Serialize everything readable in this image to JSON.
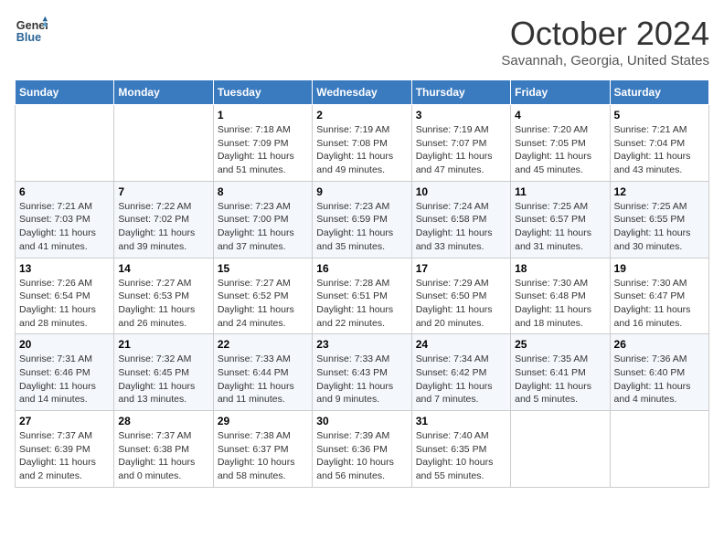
{
  "logo": {
    "line1": "General",
    "line2": "Blue"
  },
  "title": "October 2024",
  "subtitle": "Savannah, Georgia, United States",
  "days_of_week": [
    "Sunday",
    "Monday",
    "Tuesday",
    "Wednesday",
    "Thursday",
    "Friday",
    "Saturday"
  ],
  "weeks": [
    [
      {
        "day": "",
        "info": ""
      },
      {
        "day": "",
        "info": ""
      },
      {
        "day": "1",
        "info": "Sunrise: 7:18 AM\nSunset: 7:09 PM\nDaylight: 11 hours and 51 minutes."
      },
      {
        "day": "2",
        "info": "Sunrise: 7:19 AM\nSunset: 7:08 PM\nDaylight: 11 hours and 49 minutes."
      },
      {
        "day": "3",
        "info": "Sunrise: 7:19 AM\nSunset: 7:07 PM\nDaylight: 11 hours and 47 minutes."
      },
      {
        "day": "4",
        "info": "Sunrise: 7:20 AM\nSunset: 7:05 PM\nDaylight: 11 hours and 45 minutes."
      },
      {
        "day": "5",
        "info": "Sunrise: 7:21 AM\nSunset: 7:04 PM\nDaylight: 11 hours and 43 minutes."
      }
    ],
    [
      {
        "day": "6",
        "info": "Sunrise: 7:21 AM\nSunset: 7:03 PM\nDaylight: 11 hours and 41 minutes."
      },
      {
        "day": "7",
        "info": "Sunrise: 7:22 AM\nSunset: 7:02 PM\nDaylight: 11 hours and 39 minutes."
      },
      {
        "day": "8",
        "info": "Sunrise: 7:23 AM\nSunset: 7:00 PM\nDaylight: 11 hours and 37 minutes."
      },
      {
        "day": "9",
        "info": "Sunrise: 7:23 AM\nSunset: 6:59 PM\nDaylight: 11 hours and 35 minutes."
      },
      {
        "day": "10",
        "info": "Sunrise: 7:24 AM\nSunset: 6:58 PM\nDaylight: 11 hours and 33 minutes."
      },
      {
        "day": "11",
        "info": "Sunrise: 7:25 AM\nSunset: 6:57 PM\nDaylight: 11 hours and 31 minutes."
      },
      {
        "day": "12",
        "info": "Sunrise: 7:25 AM\nSunset: 6:55 PM\nDaylight: 11 hours and 30 minutes."
      }
    ],
    [
      {
        "day": "13",
        "info": "Sunrise: 7:26 AM\nSunset: 6:54 PM\nDaylight: 11 hours and 28 minutes."
      },
      {
        "day": "14",
        "info": "Sunrise: 7:27 AM\nSunset: 6:53 PM\nDaylight: 11 hours and 26 minutes."
      },
      {
        "day": "15",
        "info": "Sunrise: 7:27 AM\nSunset: 6:52 PM\nDaylight: 11 hours and 24 minutes."
      },
      {
        "day": "16",
        "info": "Sunrise: 7:28 AM\nSunset: 6:51 PM\nDaylight: 11 hours and 22 minutes."
      },
      {
        "day": "17",
        "info": "Sunrise: 7:29 AM\nSunset: 6:50 PM\nDaylight: 11 hours and 20 minutes."
      },
      {
        "day": "18",
        "info": "Sunrise: 7:30 AM\nSunset: 6:48 PM\nDaylight: 11 hours and 18 minutes."
      },
      {
        "day": "19",
        "info": "Sunrise: 7:30 AM\nSunset: 6:47 PM\nDaylight: 11 hours and 16 minutes."
      }
    ],
    [
      {
        "day": "20",
        "info": "Sunrise: 7:31 AM\nSunset: 6:46 PM\nDaylight: 11 hours and 14 minutes."
      },
      {
        "day": "21",
        "info": "Sunrise: 7:32 AM\nSunset: 6:45 PM\nDaylight: 11 hours and 13 minutes."
      },
      {
        "day": "22",
        "info": "Sunrise: 7:33 AM\nSunset: 6:44 PM\nDaylight: 11 hours and 11 minutes."
      },
      {
        "day": "23",
        "info": "Sunrise: 7:33 AM\nSunset: 6:43 PM\nDaylight: 11 hours and 9 minutes."
      },
      {
        "day": "24",
        "info": "Sunrise: 7:34 AM\nSunset: 6:42 PM\nDaylight: 11 hours and 7 minutes."
      },
      {
        "day": "25",
        "info": "Sunrise: 7:35 AM\nSunset: 6:41 PM\nDaylight: 11 hours and 5 minutes."
      },
      {
        "day": "26",
        "info": "Sunrise: 7:36 AM\nSunset: 6:40 PM\nDaylight: 11 hours and 4 minutes."
      }
    ],
    [
      {
        "day": "27",
        "info": "Sunrise: 7:37 AM\nSunset: 6:39 PM\nDaylight: 11 hours and 2 minutes."
      },
      {
        "day": "28",
        "info": "Sunrise: 7:37 AM\nSunset: 6:38 PM\nDaylight: 11 hours and 0 minutes."
      },
      {
        "day": "29",
        "info": "Sunrise: 7:38 AM\nSunset: 6:37 PM\nDaylight: 10 hours and 58 minutes."
      },
      {
        "day": "30",
        "info": "Sunrise: 7:39 AM\nSunset: 6:36 PM\nDaylight: 10 hours and 56 minutes."
      },
      {
        "day": "31",
        "info": "Sunrise: 7:40 AM\nSunset: 6:35 PM\nDaylight: 10 hours and 55 minutes."
      },
      {
        "day": "",
        "info": ""
      },
      {
        "day": "",
        "info": ""
      }
    ]
  ]
}
